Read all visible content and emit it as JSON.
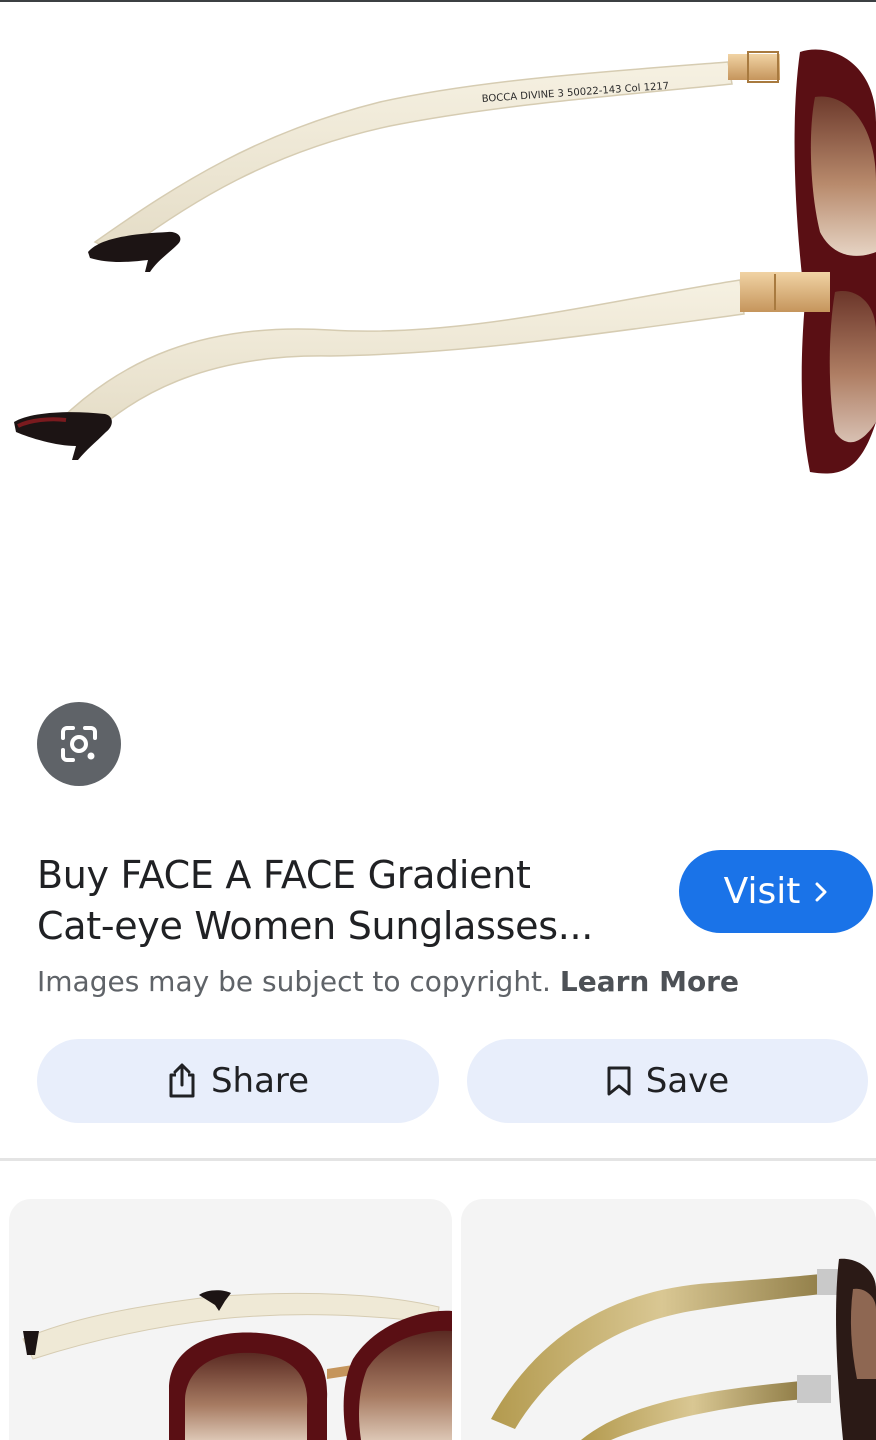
{
  "result": {
    "title_line1": "Buy FACE A FACE Gradient",
    "title_line2": "Cat-eye Women Sunglasses...",
    "copyright_text": "Images may be subject to copyright.",
    "learn_more_label": "Learn More"
  },
  "buttons": {
    "visit_label": "Visit",
    "share_label": "Share",
    "save_label": "Save"
  },
  "product_image": {
    "temple_imprint": "BOCCA DIVINE 3 50022-143 Col 1217"
  },
  "thumbnails": [
    {
      "name": "related-sunglasses-front-view"
    },
    {
      "name": "related-sunglasses-side-view"
    }
  ],
  "icons": {
    "lens": "google-lens-icon",
    "visit_arrow": "chevron-right-icon",
    "share": "share-icon",
    "save": "bookmark-icon"
  },
  "colors": {
    "accent": "#1a73e8",
    "pill_background": "#e8eefb",
    "lens_button": "#5f6368",
    "frame_burgundy": "#5a0f14",
    "temple_cream": "#efe9d6"
  }
}
